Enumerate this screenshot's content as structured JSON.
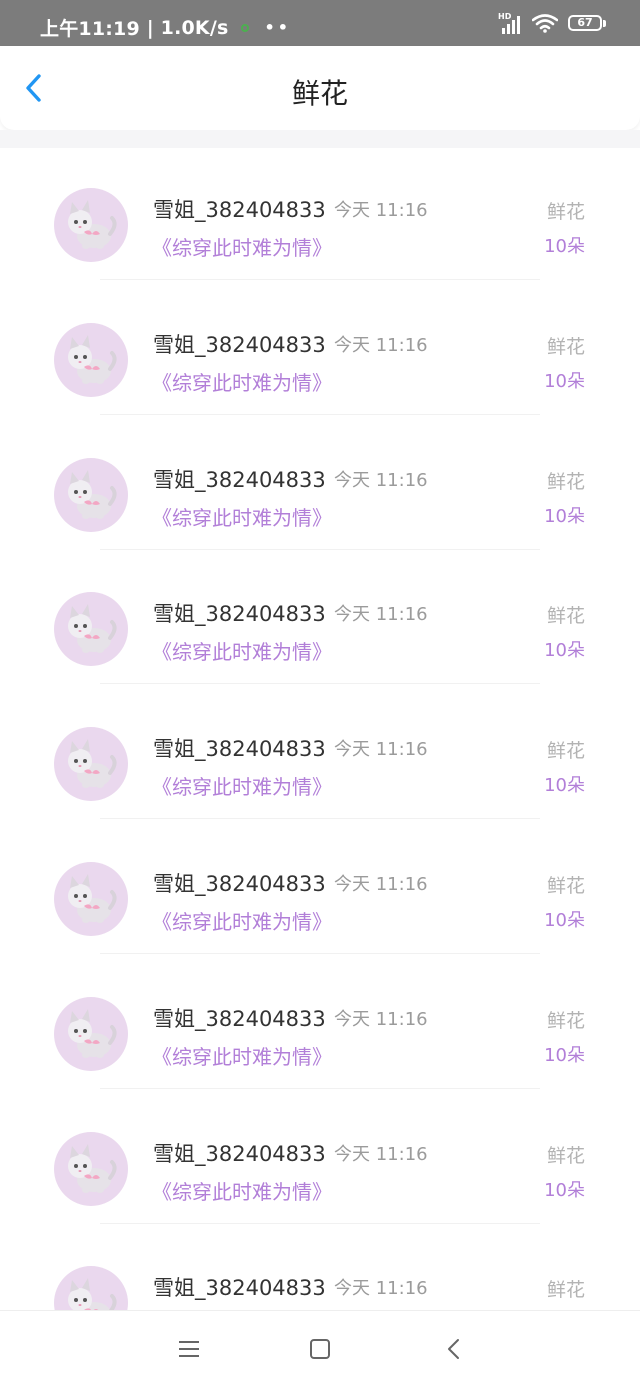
{
  "status_bar": {
    "time": "上午11:19",
    "speed": "1.0K/s",
    "dots": "••",
    "network": "HD",
    "battery": "67"
  },
  "header": {
    "title": "鲜花",
    "back_icon": "chevron-left-icon"
  },
  "list": {
    "items": [
      {
        "user": "雪姐_382404833",
        "time": "今天 11:16",
        "book": "《综穿此时难为情》",
        "gift": "鲜花",
        "count": "10朵"
      },
      {
        "user": "雪姐_382404833",
        "time": "今天 11:16",
        "book": "《综穿此时难为情》",
        "gift": "鲜花",
        "count": "10朵"
      },
      {
        "user": "雪姐_382404833",
        "time": "今天 11:16",
        "book": "《综穿此时难为情》",
        "gift": "鲜花",
        "count": "10朵"
      },
      {
        "user": "雪姐_382404833",
        "time": "今天 11:16",
        "book": "《综穿此时难为情》",
        "gift": "鲜花",
        "count": "10朵"
      },
      {
        "user": "雪姐_382404833",
        "time": "今天 11:16",
        "book": "《综穿此时难为情》",
        "gift": "鲜花",
        "count": "10朵"
      },
      {
        "user": "雪姐_382404833",
        "time": "今天 11:16",
        "book": "《综穿此时难为情》",
        "gift": "鲜花",
        "count": "10朵"
      },
      {
        "user": "雪姐_382404833",
        "time": "今天 11:16",
        "book": "《综穿此时难为情》",
        "gift": "鲜花",
        "count": "10朵"
      },
      {
        "user": "雪姐_382404833",
        "time": "今天 11:16",
        "book": "《综穿此时难为情》",
        "gift": "鲜花",
        "count": "10朵"
      },
      {
        "user": "雪姐_382404833",
        "time": "今天 11:16",
        "book": "",
        "gift": "鲜花",
        "count": ""
      }
    ]
  },
  "nav": {
    "menu_icon": "menu-icon",
    "home_icon": "home-square-icon",
    "back_icon": "back-triangle-icon"
  },
  "colors": {
    "status_bar_bg": "#7c7c7c",
    "accent_blue": "#2196f3",
    "book_purple": "#b27fd8",
    "avatar_bg": "#ead8ee"
  }
}
